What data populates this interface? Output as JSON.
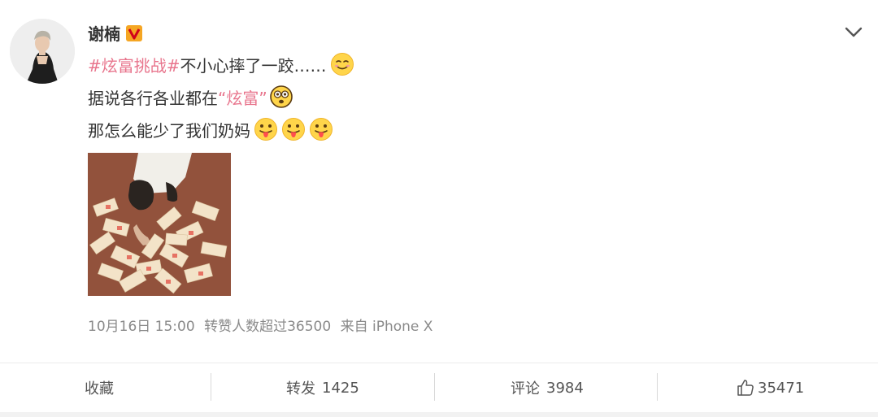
{
  "post": {
    "author": "谢楠",
    "verified_icon": "verified-v-icon",
    "line1_topic": "#炫富挑战#",
    "line1_text": " 不小心摔了一跤……",
    "line2_text_a": "据说各行各业都在",
    "line2_quote": "“炫富”",
    "line3_text": "那怎么能少了我们奶妈",
    "meta": {
      "time": "10月16日 15:00",
      "repost_info": "转赞人数超过36500",
      "source": "来自 iPhone X"
    }
  },
  "actions": {
    "favorite": "收藏",
    "repost_label": "转发",
    "repost_count": "1425",
    "comment_label": "评论",
    "comment_count": "3984",
    "like_count": "35471"
  },
  "colors": {
    "topic": "#e8748c",
    "meta": "#8a8a8a",
    "verified": "#f5a623"
  }
}
